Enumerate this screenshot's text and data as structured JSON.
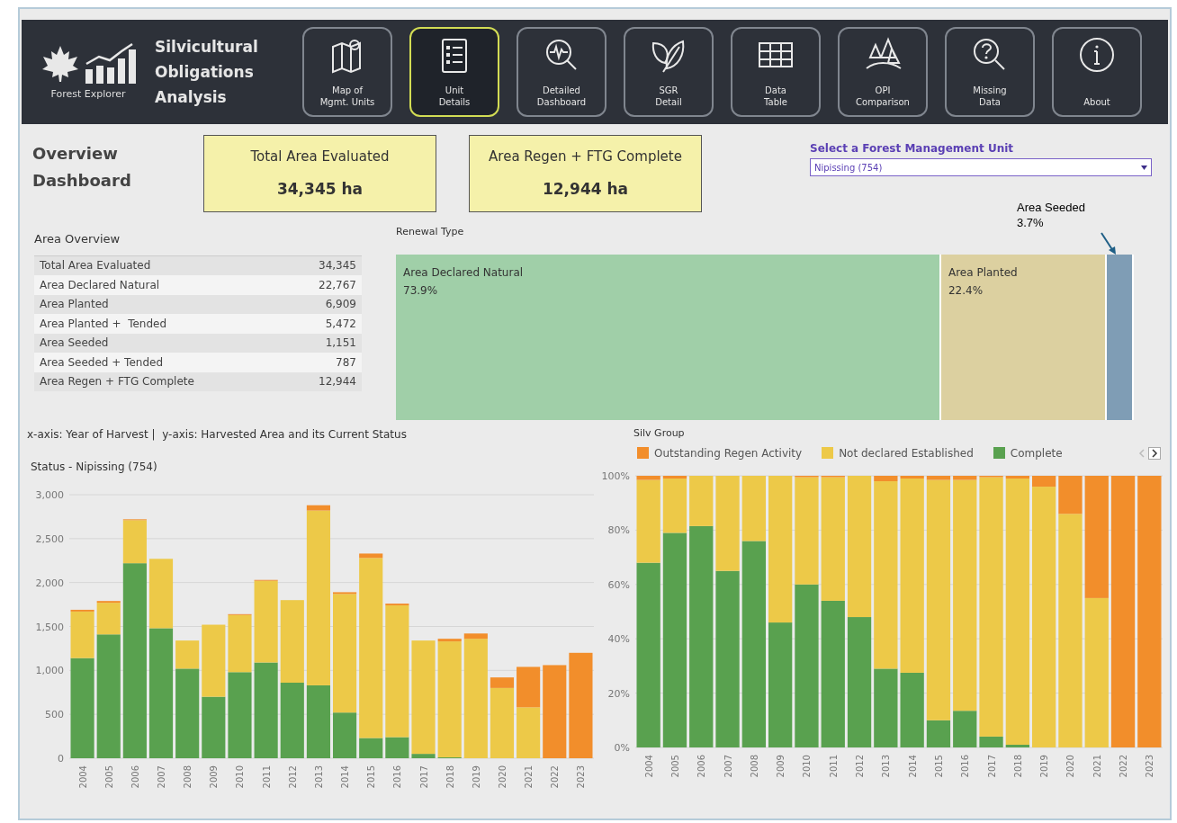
{
  "header": {
    "app_name": "Forest Explorer",
    "title": "Silvicultural\nObligations\nAnalysis",
    "nav": [
      {
        "label": "Map of\nMgmt. Units",
        "selected": false
      },
      {
        "label": "Unit\nDetails",
        "selected": true
      },
      {
        "label": "Detailed\nDashboard",
        "selected": false
      },
      {
        "label": "SGR\nDetail",
        "selected": false
      },
      {
        "label": "Data\nTable",
        "selected": false
      },
      {
        "label": "OPI\nComparison",
        "selected": false
      },
      {
        "label": "Missing\nData",
        "selected": false
      },
      {
        "label": "About",
        "selected": false
      }
    ]
  },
  "overview": {
    "title": "Overview\nDashboard",
    "kpis": [
      {
        "label": "Total Area Evaluated",
        "value": "34,345 ha"
      },
      {
        "label": "Area Regen + FTG Complete",
        "value": "12,944 ha"
      }
    ],
    "unit_select": {
      "label": "Select a Forest Management Unit",
      "value": "Nipissing (754)"
    }
  },
  "area_overview": {
    "title": "Area Overview",
    "rows": [
      {
        "label": "Total Area Evaluated",
        "value": "34,345"
      },
      {
        "label": "Area Declared Natural",
        "value": "22,767"
      },
      {
        "label": "Area Planted",
        "value": "6,909"
      },
      {
        "label": "Area Planted +  Tended",
        "value": "5,472"
      },
      {
        "label": "Area Seeded",
        "value": "1,151"
      },
      {
        "label": "Area Seeded + Tended",
        "value": "787"
      },
      {
        "label": "Area Regen + FTG Complete",
        "value": "12,944"
      }
    ]
  },
  "renewal_type": {
    "title": "Renewal Type",
    "segments": [
      {
        "label": "Area Declared Natural",
        "share": "73.9%",
        "color": "#a0cfa8",
        "kind": "inside"
      },
      {
        "label": "Area Planted",
        "share": "22.4%",
        "color": "#dcd0a0",
        "kind": "inside"
      },
      {
        "label": "Area Seeded",
        "share": "3.7%",
        "color": "#7f9db5",
        "kind": "callout"
      }
    ]
  },
  "harvest_status": {
    "caption": "x-axis: Year of Harvest |  y-axis: Harvested Area and its Current Status",
    "chart_data": {
      "type": "bar",
      "stacked": true,
      "title": "Status - Nipissing (754)",
      "categories": [
        "2004",
        "2005",
        "2006",
        "2007",
        "2008",
        "2009",
        "2010",
        "2011",
        "2012",
        "2013",
        "2014",
        "2015",
        "2016",
        "2017",
        "2018",
        "2019",
        "2020",
        "2021",
        "2022",
        "2023"
      ],
      "series": [
        {
          "color": "#f28e2b",
          "values": [
            20,
            20,
            10,
            0,
            0,
            0,
            10,
            10,
            0,
            60,
            20,
            50,
            20,
            0,
            30,
            60,
            120,
            460,
            1060,
            1200
          ]
        },
        {
          "color": "#edc948",
          "values": [
            530,
            360,
            490,
            790,
            320,
            820,
            650,
            930,
            940,
            1990,
            1350,
            2050,
            1500,
            1290,
            1320,
            1360,
            800,
            580,
            0,
            0
          ]
        },
        {
          "color": "#59a14f",
          "values": [
            1140,
            1410,
            2220,
            1480,
            1020,
            700,
            980,
            1090,
            860,
            830,
            520,
            230,
            240,
            50,
            10,
            0,
            0,
            0,
            0,
            0
          ]
        }
      ],
      "grid": true,
      "ylim": [
        0,
        3000
      ],
      "yticks": [
        {
          "value": 0,
          "label": "0"
        },
        {
          "value": 500,
          "label": "500"
        },
        {
          "value": 1000,
          "label": "1,000"
        },
        {
          "value": 1500,
          "label": "1,500"
        },
        {
          "value": 2000,
          "label": "2,000"
        },
        {
          "value": 2500,
          "label": "2,500"
        },
        {
          "value": 3000,
          "label": "3,000"
        }
      ]
    }
  },
  "silv_group": {
    "legend_title": "Silv Group",
    "chart_data": {
      "type": "bar",
      "stacked": true,
      "categories": [
        "2004",
        "2005",
        "2006",
        "2007",
        "2008",
        "2009",
        "2010",
        "2011",
        "2012",
        "2013",
        "2014",
        "2015",
        "2016",
        "2017",
        "2018",
        "2019",
        "2020",
        "2021",
        "2022",
        "2023"
      ],
      "series": [
        {
          "name": "Outstanding Regen Activity",
          "color": "#f28e2b",
          "values": [
            1.5,
            1,
            0,
            0,
            0,
            0,
            0.5,
            0.5,
            0,
            2,
            1,
            1.5,
            1.5,
            0.5,
            1,
            4,
            14,
            45,
            100,
            100
          ]
        },
        {
          "name": "Not declared Established",
          "color": "#edc948",
          "values": [
            30.5,
            20,
            18.5,
            35,
            24,
            54,
            39.5,
            45.5,
            52,
            69,
            71.5,
            88.5,
            85,
            95.5,
            98,
            96,
            86,
            55,
            0,
            0
          ]
        },
        {
          "name": "Complete",
          "color": "#59a14f",
          "values": [
            68,
            79,
            81.5,
            65,
            76,
            46,
            60,
            54,
            48,
            29,
            27.5,
            10,
            13.5,
            4,
            1,
            0,
            0,
            0,
            0,
            0
          ]
        }
      ],
      "grid": true,
      "ylim": [
        0,
        100
      ],
      "yticks": [
        {
          "value": 0,
          "label": "0%"
        },
        {
          "value": 20,
          "label": "20%"
        },
        {
          "value": 40,
          "label": "40%"
        },
        {
          "value": 60,
          "label": "60%"
        },
        {
          "value": 80,
          "label": "80%"
        },
        {
          "value": 100,
          "label": "100%"
        }
      ]
    }
  }
}
